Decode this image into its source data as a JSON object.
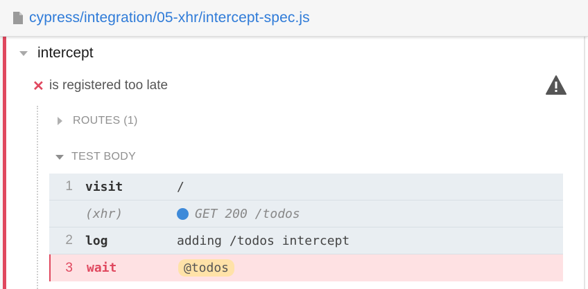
{
  "header": {
    "file_icon": "file-icon",
    "path": "cypress/integration/05-xhr/intercept-spec.js"
  },
  "suite": {
    "title": "intercept"
  },
  "test": {
    "status_icon": "x",
    "title": "is registered too late",
    "warning_icon": "warning-icon"
  },
  "sections": {
    "routes": "ROUTES (1)",
    "test_body": "TEST BODY"
  },
  "commands": [
    {
      "num": "1",
      "name": "visit",
      "message": "/"
    },
    {
      "num": "",
      "name": "(xhr)",
      "message": "GET 200 /todos"
    },
    {
      "num": "2",
      "name": "log",
      "message": "adding /todos intercept"
    },
    {
      "num": "3",
      "name": "wait",
      "message": "@todos"
    }
  ],
  "colors": {
    "link": "#2f7bd8",
    "fail": "#e0485f",
    "command_bg": "#e9eef2",
    "failed_bg": "#fee1e3",
    "alias_bg": "#ffe2a8",
    "xhr_dot": "#3e8ad9"
  }
}
